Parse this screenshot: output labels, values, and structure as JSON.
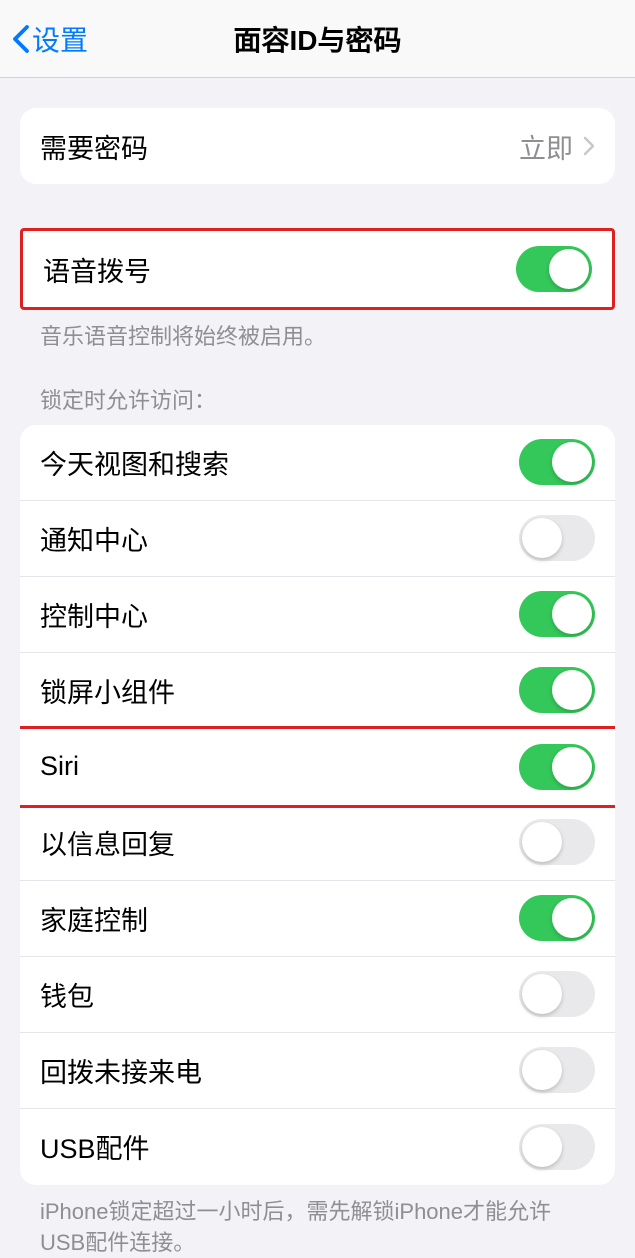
{
  "header": {
    "back_label": "设置",
    "title": "面容ID与密码"
  },
  "group1": {
    "row1": {
      "label": "需要密码",
      "value": "立即"
    }
  },
  "group2": {
    "row1": {
      "label": "语音拨号",
      "on": true
    },
    "caption": "音乐语音控制将始终被启用。"
  },
  "section3_header": "锁定时允许访问：",
  "group3": {
    "items": [
      {
        "label": "今天视图和搜索",
        "on": true,
        "highlighted": false
      },
      {
        "label": "通知中心",
        "on": false,
        "highlighted": false
      },
      {
        "label": "控制中心",
        "on": true,
        "highlighted": false
      },
      {
        "label": "锁屏小组件",
        "on": true,
        "highlighted": false
      },
      {
        "label": "Siri",
        "on": true,
        "highlighted": true
      },
      {
        "label": "以信息回复",
        "on": false,
        "highlighted": false
      },
      {
        "label": "家庭控制",
        "on": true,
        "highlighted": false
      },
      {
        "label": "钱包",
        "on": false,
        "highlighted": false
      },
      {
        "label": "回拨未接来电",
        "on": false,
        "highlighted": false
      },
      {
        "label": "USB配件",
        "on": false,
        "highlighted": false
      }
    ],
    "caption": "iPhone锁定超过一小时后，需先解锁iPhone才能允许USB配件连接。"
  }
}
